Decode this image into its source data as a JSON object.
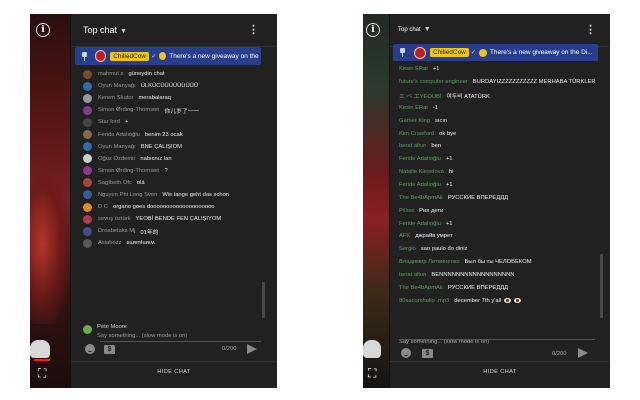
{
  "left": {
    "header": {
      "title": "Top chat",
      "menu_icon": "kebab-icon"
    },
    "pinned": {
      "author": "ChilledCow",
      "text": "There's a new giveaway on the Di..."
    },
    "messages": [
      {
        "author": "mahmut s",
        "text": "güneydin chat",
        "color": "#7a4a2a"
      },
      {
        "author": "Oyun Manyağı",
        "text": "ÜLKÜCÜÜÜÜÜÜÜÜÜ",
        "color": "#2c6ea8"
      },
      {
        "author": "Kerem Skutor",
        "text": "merabalaraq",
        "color": "#9a9a9a"
      },
      {
        "author": "Simon Ørding-Thomsen",
        "text": "你儿岁了一一",
        "color": "#8a3a8a"
      },
      {
        "author": "Star lord",
        "text": "+",
        "color": "#444444"
      },
      {
        "author": "Feride Adalıoğlu",
        "text": "benim 23 ocak",
        "color": "#8a6a4a"
      },
      {
        "author": "Oyun Manyağı",
        "text": "BNE ÇALIŞIOM",
        "color": "#2c6ea8"
      },
      {
        "author": "Oğuz Özdemir",
        "text": "nabıcnız lan",
        "color": "#cccccc"
      },
      {
        "author": "Simon Ørding-Thomsen",
        "text": "?",
        "color": "#8a3a8a"
      },
      {
        "author": "Sagtbeth Ofc",
        "text": "olá",
        "color": "#a84a3a"
      },
      {
        "author": "Nguyen Phi Long Sven",
        "text": "Wie lange geht das schon",
        "color": "#3a5a9a"
      },
      {
        "author": "D C",
        "text": "organo goes doooooooooooooooooooo",
        "color": "#e08a2a"
      },
      {
        "author": "sevıış öztürk",
        "text": "YEOBİ BENDE FEN ÇALIŞIYOM",
        "color": "#b23a4a"
      },
      {
        "author": "Droabetaks Mj",
        "text": "01年的",
        "color": "#4a4a8a"
      },
      {
        "author": "Asiabozz",
        "text": "ɕɯɐnɬɯɐʍ",
        "color": "#5a5a5a"
      }
    ],
    "last_message": {
      "author": "Pete Moore",
      "placeholder": "Say something... (slow mode is on)"
    },
    "counter": "0/200",
    "hide_chat": "HIDE CHAT"
  },
  "right": {
    "header": {
      "title": "Top chat",
      "menu_icon": "kebab-icon"
    },
    "pinned": {
      "author": "ChilledCow",
      "text": "There's a new giveaway on the Di..."
    },
    "messages": [
      {
        "author": "Kesin ERai",
        "text": "+1",
        "color": "#5aa05a"
      },
      {
        "author": "future's computer engineer",
        "text": "BURDAYIZZZZZZZZZZZ MERHABA TÜRKLER",
        "color": "#5aa05a"
      },
      {
        "author": "エ ベ エYEOUBİ",
        "text": "여두비 ATATÜRK",
        "color": "#5aa05a"
      },
      {
        "author": "Kesin ERai",
        "text": "-1",
        "color": "#5aa05a"
      },
      {
        "author": "Gamer King",
        "text": "sıcın",
        "color": "#5aa05a"
      },
      {
        "author": "Kim Crawford",
        "text": "ok bye",
        "color": "#5aa05a"
      },
      {
        "author": "berat altun",
        "text": "ben",
        "color": "#5aa05a"
      },
      {
        "author": "Feride Adalıoğlu",
        "text": "+1",
        "color": "#5aa05a"
      },
      {
        "author": "Natalie Kieselová",
        "text": "hi",
        "color": "#5aa05a"
      },
      {
        "author": "Feride Adalıoğlu",
        "text": "+1",
        "color": "#5aa05a"
      },
      {
        "author": "The Be4bApmAk",
        "text": "РУССКИЕ ВПЕРЕДДД",
        "color": "#5aa05a"
      },
      {
        "author": "Pillow",
        "text": "Рия дети",
        "color": "#5aa05a"
      },
      {
        "author": "Feride Adalıoğlu",
        "text": "+1",
        "color": "#5aa05a"
      },
      {
        "author": "AFK",
        "text": "джрайв умрет",
        "color": "#5aa05a"
      },
      {
        "author": "Sergio",
        "text": "sao paulo do diniz",
        "color": "#5aa05a"
      },
      {
        "author": "Владимир Литвиненко",
        "text": "Был бы ты ЧЕЛОВЕКОМ",
        "color": "#5aa05a"
      },
      {
        "author": "berat altun",
        "text": "BENNNNNNNNNNNNNNNNNN",
        "color": "#5aa05a"
      },
      {
        "author": "The Be4bApmAk",
        "text": "РУССКИЕ ВПЕРЕДДД",
        "color": "#5aa05a"
      },
      {
        "author": "80sacomholio .mp3",
        "text": "december 7th y'all",
        "color": "#5aa05a",
        "eyes": true
      }
    ],
    "placeholder": "Say something... (slow mode is on)",
    "counter": "0/200",
    "hide_chat": "HIDE CHAT"
  },
  "colors": {
    "chat_bg": "#212121",
    "pinned_bg": "#283e8c",
    "badge": "#f2c418",
    "author_green": "#5aa05a"
  }
}
